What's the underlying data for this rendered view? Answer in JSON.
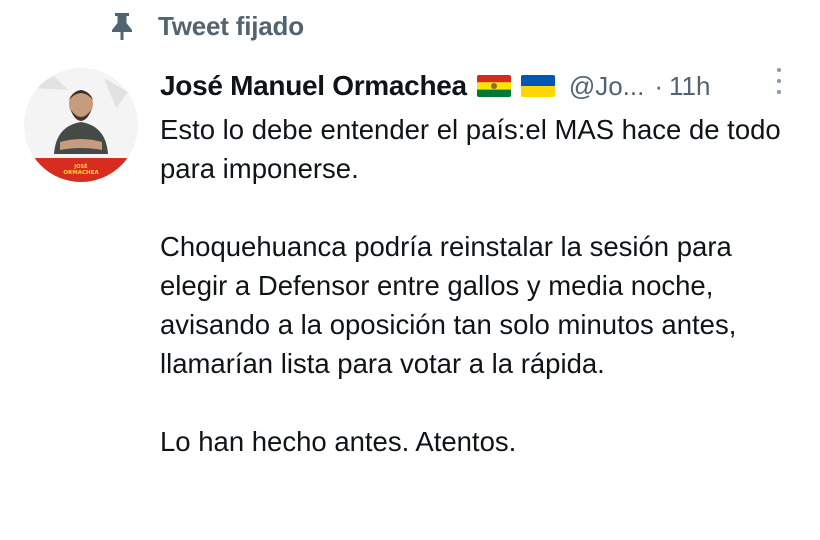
{
  "pinned": {
    "label": "Tweet fijado",
    "icon": "pin-icon"
  },
  "author": {
    "name": "José Manuel Ormachea",
    "flags": [
      "bolivia-flag",
      "ukraine-flag"
    ],
    "handle": "@Jo...",
    "separator": "·",
    "time": "11h",
    "avatar_text": "JOSÉ ORMACHEA"
  },
  "tweet": {
    "paragraphs": [
      "Esto lo debe entender el país:el MAS hace de todo para imponerse.",
      "Choquehuanca podría reinstalar la sesión para elegir a Defensor entre gallos y media noche, avisando a la oposición tan solo minutos antes, llamarían lista para votar a la rápida.",
      "Lo han hecho antes. Atentos."
    ]
  },
  "colors": {
    "text": "#0f1419",
    "muted": "#536471",
    "bolivia": [
      "#d52b1e",
      "#f9e300",
      "#007934"
    ],
    "ukraine": [
      "#0057b7",
      "#ffd700"
    ]
  }
}
